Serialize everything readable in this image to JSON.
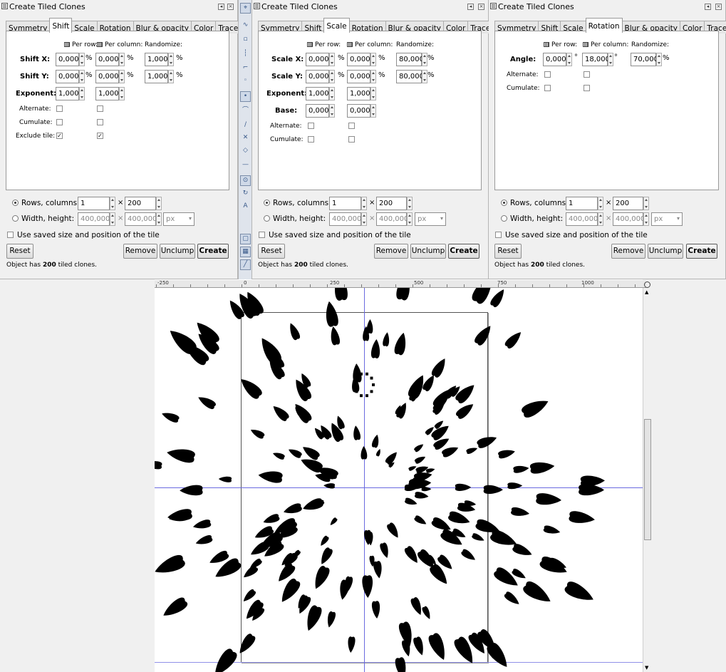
{
  "panels": [
    {
      "title": "Create Tiled Clones",
      "tabs": [
        "Symmetry",
        "Shift",
        "Scale",
        "Rotation",
        "Blur & opacity",
        "Color",
        "Trace"
      ],
      "active_tab": "Shift",
      "headers": {
        "per_row": "Per row:",
        "per_column": "Per column:",
        "randomize": "Randomize:"
      },
      "shift_x_label": "Shift X:",
      "shift_y_label": "Shift Y:",
      "exponent_label": "Exponent:",
      "alternate_label": "Alternate:",
      "cumulate_label": "Cumulate:",
      "exclude_tile_label": "Exclude tile:",
      "shift_x": {
        "row": "0,000",
        "col": "0,000",
        "rand": "1,000"
      },
      "shift_y": {
        "row": "0,000",
        "col": "0,000",
        "rand": "1,000"
      },
      "exponent": {
        "row": "1,000",
        "col": "1,000"
      },
      "unit_percent": "%",
      "alternate": {
        "row": false,
        "col": false
      },
      "cumulate": {
        "row": false,
        "col": false
      },
      "exclude_tile": {
        "row": true,
        "col": true
      },
      "rows_columns_label": "Rows, columns:",
      "rows": "1",
      "columns": "200",
      "times": "×",
      "width_height_label": "Width, height:",
      "width": "400,0000",
      "height": "400,0000",
      "size_unit": "px",
      "use_saved_label": "Use saved size and position of the tile",
      "reset_label": "Reset",
      "remove_label": "Remove",
      "unclump_label": "Unclump",
      "create_label": "Create",
      "status_prefix": "Object has ",
      "status_count": "200",
      "status_suffix": " tiled clones."
    },
    {
      "title": "Create Tiled Clones",
      "tabs": [
        "Symmetry",
        "Shift",
        "Scale",
        "Rotation",
        "Blur & opacity",
        "Color",
        "Trace"
      ],
      "active_tab": "Scale",
      "headers": {
        "per_row": "Per row:",
        "per_column": "Per column:",
        "randomize": "Randomize:"
      },
      "scale_x_label": "Scale X:",
      "scale_y_label": "Scale Y:",
      "exponent_label": "Exponent:",
      "base_label": "Base:",
      "alternate_label": "Alternate:",
      "cumulate_label": "Cumulate:",
      "scale_x": {
        "row": "0,000",
        "col": "0,000",
        "rand": "80,000"
      },
      "scale_y": {
        "row": "0,000",
        "col": "0,000",
        "rand": "80,000"
      },
      "exponent": {
        "row": "1,000",
        "col": "1,000"
      },
      "base": {
        "row": "0,000",
        "col": "0,000"
      },
      "unit_percent": "%",
      "alternate": {
        "row": false,
        "col": false
      },
      "cumulate": {
        "row": false,
        "col": false
      },
      "rows_columns_label": "Rows, columns:",
      "rows": "1",
      "columns": "200",
      "times": "×",
      "width_height_label": "Width, height:",
      "width": "400,0000",
      "height": "400,0000",
      "size_unit": "px",
      "use_saved_label": "Use saved size and position of the tile",
      "reset_label": "Reset",
      "remove_label": "Remove",
      "unclump_label": "Unclump",
      "create_label": "Create",
      "status_prefix": "Object has ",
      "status_count": "200",
      "status_suffix": " tiled clones."
    },
    {
      "title": "Create Tiled Clones",
      "tabs": [
        "Symmetry",
        "Shift",
        "Scale",
        "Rotation",
        "Blur & opacity",
        "Color",
        "Trace"
      ],
      "active_tab": "Rotation",
      "headers": {
        "per_row": "Per row:",
        "per_column": "Per column:",
        "randomize": "Randomize:"
      },
      "angle_label": "Angle:",
      "alternate_label": "Alternate:",
      "cumulate_label": "Cumulate:",
      "angle": {
        "row": "0,000",
        "col": "18,000",
        "rand": "70,000"
      },
      "unit_degree": "°",
      "unit_percent": "%",
      "alternate": {
        "row": false,
        "col": false
      },
      "cumulate": {
        "row": false,
        "col": false
      },
      "rows_columns_label": "Rows, columns:",
      "rows": "1",
      "columns": "200",
      "times": "×",
      "width_height_label": "Width, height:",
      "width": "400,0000",
      "height": "400,0000",
      "size_unit": "px",
      "use_saved_label": "Use saved size and position of the tile",
      "reset_label": "Reset",
      "remove_label": "Remove",
      "unclump_label": "Unclump",
      "create_label": "Create",
      "status_prefix": "Object has ",
      "status_count": "200",
      "status_suffix": " tiled clones."
    }
  ],
  "toolbar": {
    "icons": [
      "node-tool-icon",
      "bezier-icon",
      "snap-bbox-icon",
      "snap-edge-icon",
      "snap-corner-icon",
      "snap-midpoint-icon",
      "snap-nodes-icon",
      "snap-smooth-icon",
      "snap-path-icon",
      "snap-intersection-icon",
      "snap-cusp-icon",
      "snap-line-icon",
      "snap-center-icon",
      "snap-rotation-icon",
      "snap-text-icon",
      "snap-page-icon",
      "snap-grid-icon",
      "snap-guide-icon"
    ]
  },
  "ruler": {
    "labels": [
      "-250",
      "0",
      "250",
      "500",
      "750",
      "1000"
    ]
  },
  "colors": {
    "guide": "#6a6ae0",
    "shape": "#000000",
    "accent_toolbar": "#3a5a8a"
  }
}
